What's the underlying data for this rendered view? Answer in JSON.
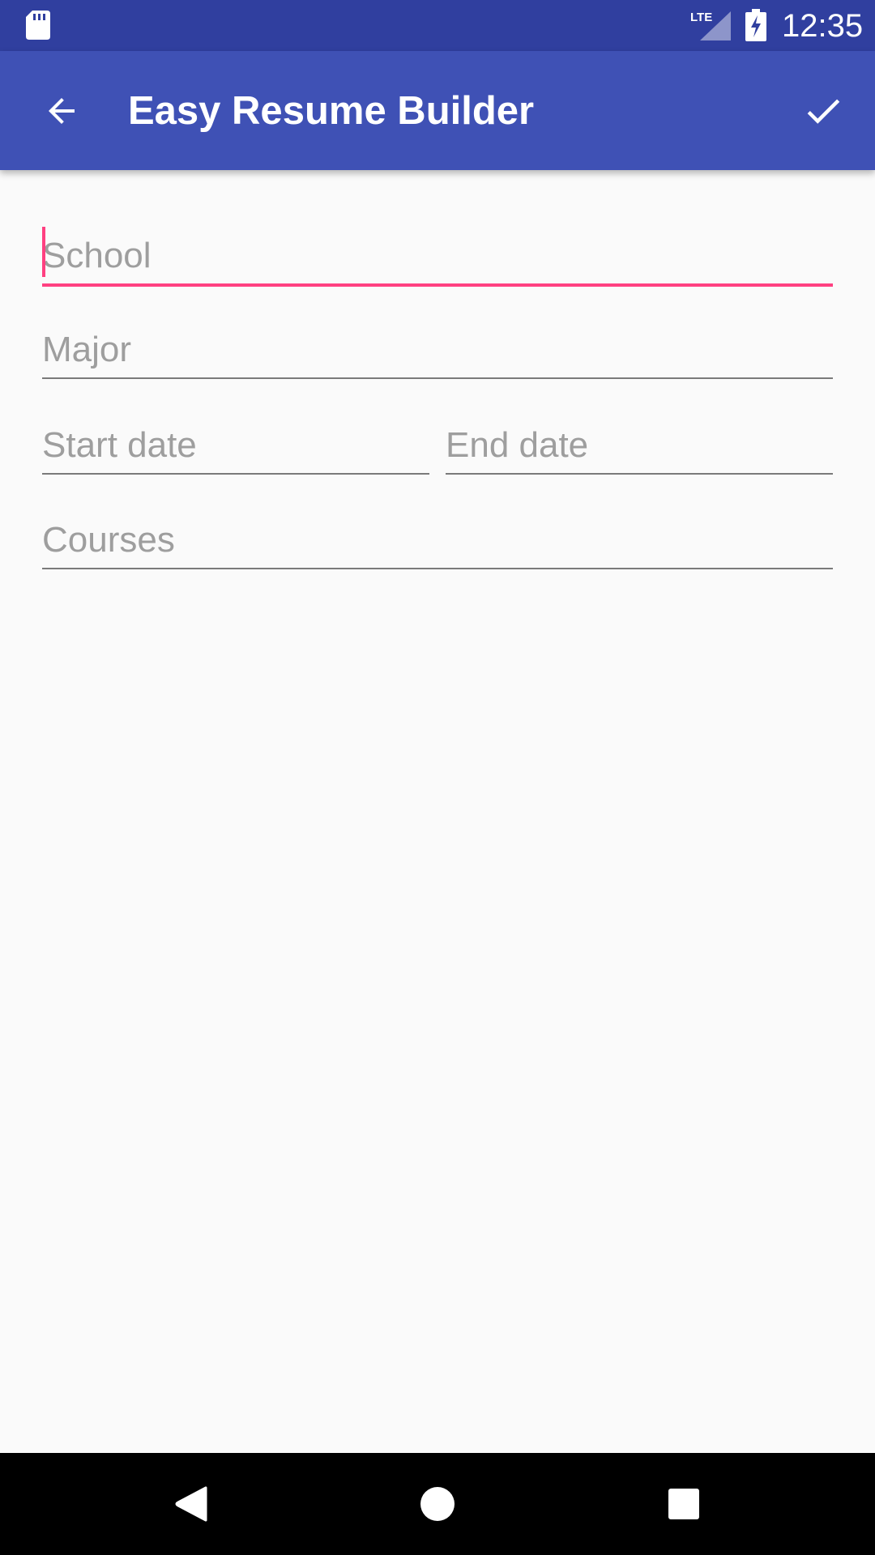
{
  "status_bar": {
    "time": "12:35",
    "network_label": "LTE",
    "icons": [
      "sd-card-icon",
      "lte-signal-icon",
      "battery-charging-icon"
    ]
  },
  "app_bar": {
    "title": "Easy Resume Builder",
    "back_icon": "arrow-back-icon",
    "done_icon": "check-icon"
  },
  "form": {
    "school": {
      "placeholder": "School",
      "value": ""
    },
    "major": {
      "placeholder": "Major",
      "value": ""
    },
    "start_date": {
      "placeholder": "Start date",
      "value": ""
    },
    "end_date": {
      "placeholder": "End date",
      "value": ""
    },
    "courses": {
      "placeholder": "Courses",
      "value": ""
    },
    "focused_field": "school"
  },
  "nav_bar": {
    "icons": [
      "nav-back-icon",
      "nav-home-icon",
      "nav-recents-icon"
    ]
  },
  "colors": {
    "status_bar": "#303f9f",
    "app_bar": "#3f51b5",
    "accent": "#ff4081",
    "background": "#fafafa",
    "hint_text": "#9e9e9e"
  }
}
